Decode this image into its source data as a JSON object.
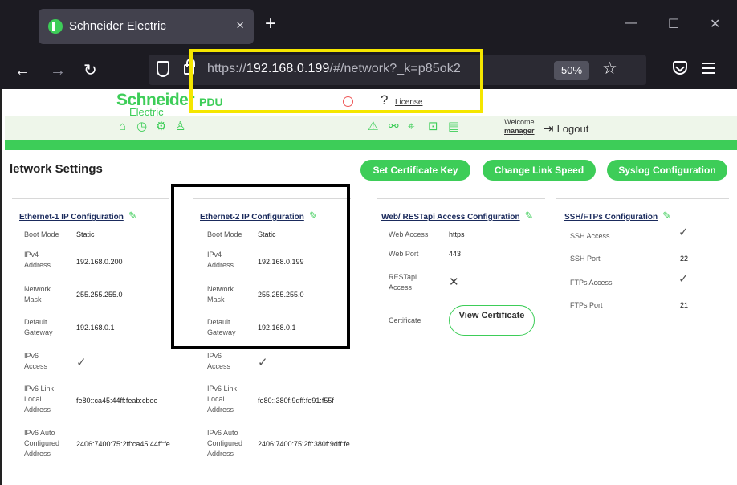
{
  "browser": {
    "tab_title": "Schneider Electric",
    "tab_close": "×",
    "new_tab": "+",
    "url_prefix": "https://",
    "url_host": "192.168.0.199",
    "url_path": "/#/network?_k=p85ok2",
    "zoom": "50%",
    "window_controls": [
      "—",
      "☐",
      "✕"
    ]
  },
  "header": {
    "logo_line1": "Schneider",
    "logo_line2": "Electric",
    "product": "PDU",
    "help_glyph": "?",
    "license": "License",
    "welcome": "Welcome",
    "user": "manager",
    "logout": "Logout",
    "left_icons": [
      "home-icon",
      "history-icon",
      "settings-icon",
      "users-icon"
    ],
    "right_icons": [
      "alarm-icon",
      "network-icon",
      "location-icon",
      "lock-icon",
      "storage-icon"
    ]
  },
  "page": {
    "title": "letwork Settings",
    "buttons": {
      "set_cert_key": "Set Certificate Key",
      "change_link_speed": "Change Link Speed",
      "syslog": "Syslog Configuration"
    }
  },
  "eth1": {
    "heading": "Ethernet-1 IP Configuration",
    "boot_mode_label": "Boot Mode",
    "boot_mode": "Static",
    "ipv4_label": "IPv4 Address",
    "ipv4": "192.168.0.200",
    "mask_label": "Network Mask",
    "mask": "255.255.255.0",
    "gateway_label": "Default Gateway",
    "gateway": "192.168.0.1",
    "ipv6_access_label": "IPv6 Access",
    "ipv6_link_label": "IPv6 Link Local Address",
    "ipv6_link": "fe80::ca45:44ff:feab:cbee",
    "ipv6_auto_label": "IPv6 Auto Configured Address",
    "ipv6_auto": "2406:7400:75:2ff:ca45:44ff:fe"
  },
  "eth2": {
    "heading": "Ethernet-2 IP Configuration",
    "boot_mode_label": "Boot Mode",
    "boot_mode": "Static",
    "ipv4_label": "IPv4 Address",
    "ipv4": "192.168.0.199",
    "mask_label": "Network Mask",
    "mask": "255.255.255.0",
    "gateway_label": "Default Gateway",
    "gateway": "192.168.0.1",
    "ipv6_access_label": "IPv6 Access",
    "ipv6_link_label": "IPv6 Link Local Address",
    "ipv6_link": "fe80::380f:9dff:fe91:f55f",
    "ipv6_auto_label": "IPv6 Auto Configured Address",
    "ipv6_auto": "2406:7400:75:2ff:380f:9dff:fe"
  },
  "web": {
    "heading": "Web/ RESTapi Access Configuration",
    "web_access_label": "Web Access",
    "web_access": "https",
    "web_port_label": "Web Port",
    "web_port": "443",
    "restapi_label": "RESTapi Access",
    "certificate_label": "Certificate",
    "view_cert": "View Certificate"
  },
  "ssh": {
    "heading": "SSH/FTPs Configuration",
    "ssh_access_label": "SSH Access",
    "ssh_port_label": "SSH Port",
    "ssh_port": "22",
    "ftps_access_label": "FTPs Access",
    "ftps_port_label": "FTPs Port",
    "ftps_port": "21"
  },
  "colors": {
    "brand_green": "#3dcd58",
    "highlight_yellow": "#f5e600",
    "browser_dark": "#1c1b22"
  }
}
